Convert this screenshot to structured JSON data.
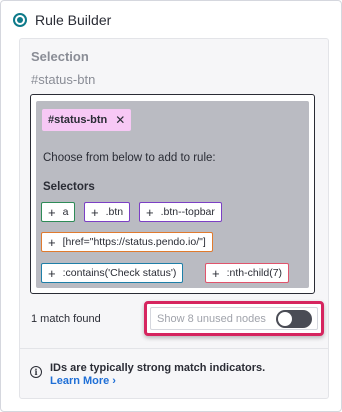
{
  "header": {
    "title": "Rule Builder",
    "radio_checked": true
  },
  "selection": {
    "title": "Selection",
    "current_selector": "#status-btn"
  },
  "builder": {
    "active_chip": {
      "label": "#status-btn",
      "close_glyph": "✕",
      "color": "#f7c8f5"
    },
    "instruction": "Choose from below to add to rule:",
    "selectors_heading": "Selectors",
    "plus_glyph": "+",
    "selectors": [
      {
        "label": "a",
        "color": "#2e8b57"
      },
      {
        "label": ".btn",
        "color": "#7b3fc4"
      },
      {
        "label": ".btn--topbar",
        "color": "#7b3fc4"
      },
      {
        "label": "[href=\"https://status.pendo.io/\"]",
        "color": "#e07a2e"
      },
      {
        "label": ":contains('Check status')",
        "color": "#1e7fa8"
      },
      {
        "label": ":nth-child(7)",
        "color": "#e0546c"
      }
    ]
  },
  "results": {
    "match_count": "1 match found",
    "unused_nodes_label": "Show 8 unused nodes",
    "unused_nodes_enabled": false,
    "highlight_color": "#d6255f"
  },
  "info": {
    "icon": "info-icon",
    "text": "IDs are typically strong match indicators.",
    "link_label": "Learn More",
    "link_chevron": "›"
  },
  "colors": {
    "accent": "#0e7a8a",
    "link": "#1f6fd6"
  }
}
